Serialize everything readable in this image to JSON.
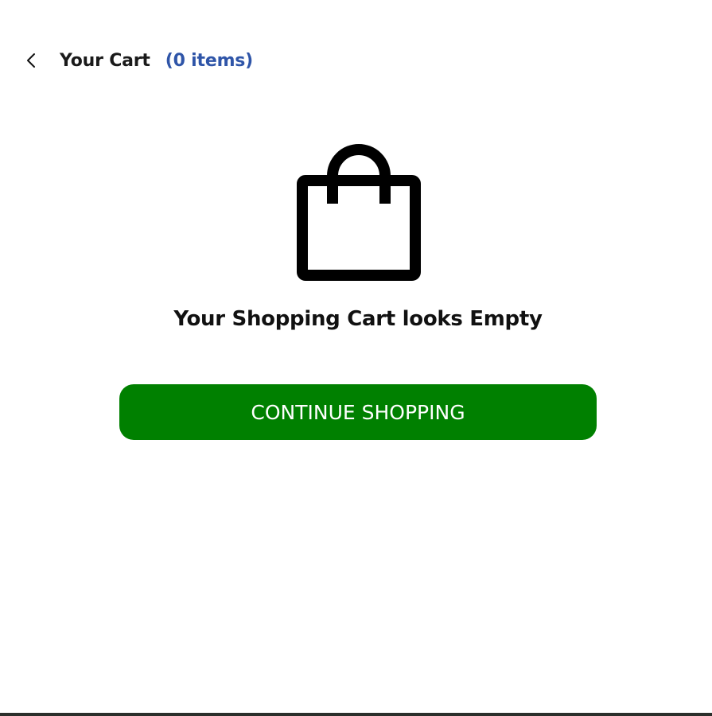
{
  "header": {
    "back_icon": "chevron-left-icon",
    "title": "Your Cart",
    "count_label": "(0 items)"
  },
  "empty_state": {
    "icon": "shopping-bag-icon",
    "message": "Your Shopping Cart looks Empty"
  },
  "actions": {
    "continue_label": "CONTINUE SHOPPING"
  },
  "colors": {
    "accent_blue": "#2f55a8",
    "button_green": "#008000",
    "text": "#111111",
    "background": "#ffffff"
  }
}
